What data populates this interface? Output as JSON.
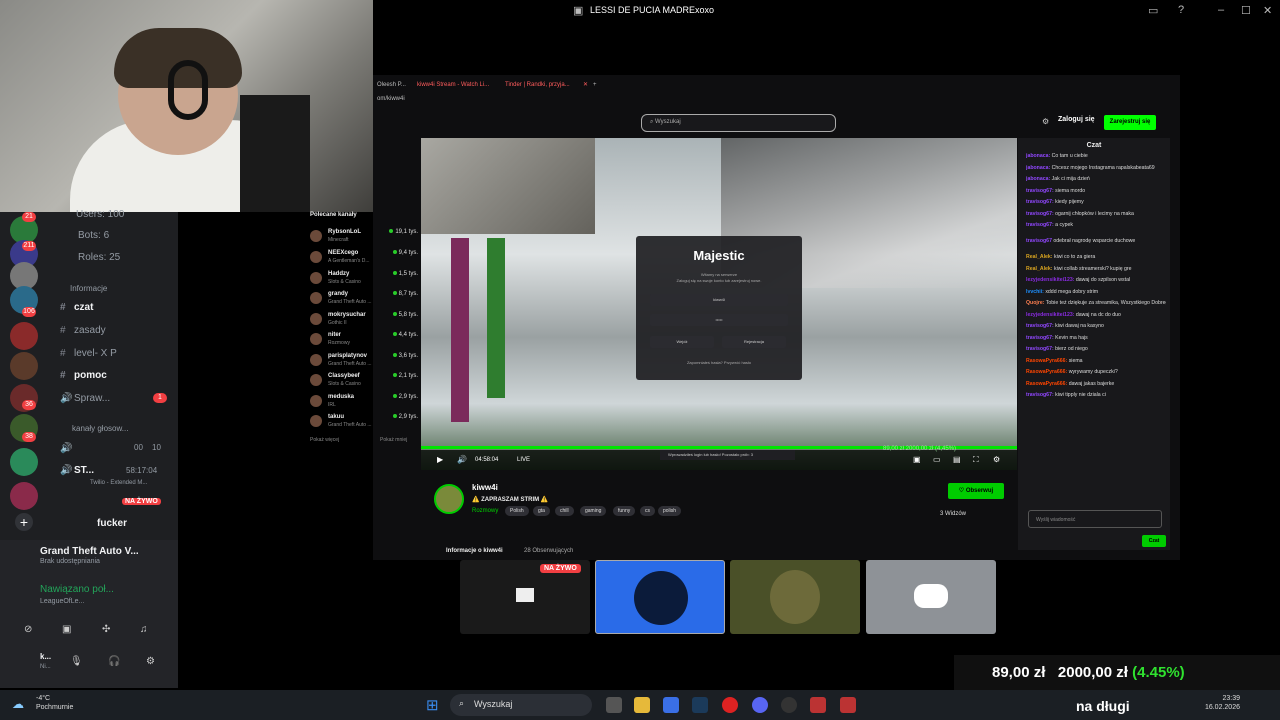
{
  "window": {
    "title": "LESSI DE PUCIA MADRExoxo"
  },
  "discord": {
    "server_counts": [
      "21",
      "211",
      "106",
      "36",
      "38"
    ],
    "server_small_badges": [
      "1",
      "1",
      "1",
      "1",
      "2",
      "1",
      "3"
    ],
    "stats": [
      "Users: 100",
      "Bots: 6",
      "Roles: 25"
    ],
    "category_info": "Informacje",
    "channels": [
      {
        "name": "czat",
        "active": true
      },
      {
        "name": "zasady",
        "active": false
      },
      {
        "name": "level- X P",
        "active": false
      },
      {
        "name": "pomoc",
        "active": true
      }
    ],
    "voice_channel": "Spraw...",
    "voice_badge": "1",
    "category_voice": "kanały głosow...",
    "voice_row_counts": [
      "00",
      "10"
    ],
    "voice_user_prefix": "ST...",
    "activity_time": "58:17:04",
    "activity_line": "Twilio - Extended M...",
    "live_label": "NA ŻYWO",
    "member_name": "fucker",
    "game_activity": {
      "title": "Grand Theft Auto V...",
      "subtitle": "Brak udostępniania"
    },
    "connection": {
      "status": "Nawiązano poł...",
      "server": "LeagueOfLe..."
    },
    "user": {
      "name": "k...",
      "status": "Ni..."
    },
    "thumbnails": [
      {
        "label": "NA ŻYWO",
        "kind": "screen"
      },
      {
        "label": "",
        "kind": "voice-active"
      },
      {
        "label": "",
        "kind": "avatar"
      },
      {
        "label": "",
        "kind": "discord-logo"
      }
    ]
  },
  "browser": {
    "tabs": [
      "Oleesh P...",
      "kiww4i Stream - Watch Li...",
      "Tinder | Randki, przyja..."
    ],
    "url_fragment": "om/kiww4i",
    "search_placeholder": "Wyszukaj",
    "login_label": "Zaloguj się",
    "signup_label": "Zarejestruj się"
  },
  "recommended": {
    "header": "Polecane kanały",
    "channels": [
      {
        "name": "RybsonLoL",
        "game": "Minecraft",
        "viewers": "19,1 tys."
      },
      {
        "name": "NEEXcego",
        "game": "A Gentleman's D...",
        "viewers": "9,4 tys."
      },
      {
        "name": "Haddzy",
        "game": "Slots & Casino",
        "viewers": "1,5 tys."
      },
      {
        "name": "grandy",
        "game": "Grand Theft Auto ...",
        "viewers": "8,7 tys."
      },
      {
        "name": "mokrysuchar",
        "game": "Gothic II",
        "viewers": "5,8 tys."
      },
      {
        "name": "niter",
        "game": "Rozmowy",
        "viewers": "4,4 tys."
      },
      {
        "name": "parisplatynov",
        "game": "Grand Theft Auto ...",
        "viewers": "3,6 tys."
      },
      {
        "name": "Classybeef",
        "game": "Slots & Casino",
        "viewers": "2,1 tys."
      },
      {
        "name": "meduska",
        "game": "IRL",
        "viewers": "2,9 tys."
      },
      {
        "name": "takuu",
        "game": "Grand Theft Auto ...",
        "viewers": "2,9 tys."
      }
    ],
    "show_more": "Pokaż więcej",
    "show_less": "Pokaż mniej"
  },
  "video": {
    "login_logo": "Majestic",
    "login_sub": "Witamy na serwerze",
    "login_sub2": "Zaloguj się na swoje konto lub zarejestruj nowe.",
    "login_field_1": "kiww4i",
    "login_field_2": "•••••",
    "login_btn_1": "Wejdź",
    "login_btn_2": "Rejestracja",
    "login_footer": "Zapomniałeś hasła?  Przywróć hasło",
    "time": "04:58:04",
    "live": "LIVE",
    "message": "Wprowadziłeś login lub hasło! Pozostało prób: 3",
    "overlay_text": "89,00 zł  2000,00 zł  (4,45%)"
  },
  "stream": {
    "channel": "kiww4i",
    "title": "⚠️ ZAPRASZAM STRIM ⚠️",
    "category": "Rozmowy",
    "tags": [
      "Polish",
      "gta",
      "chill",
      "gaming",
      "funny",
      "cs",
      "polish"
    ],
    "follow": "Obserwuj",
    "viewers": "3 Widzów",
    "about": "Informacje o kiww4i",
    "followers": "28 Obserwujących"
  },
  "chat": {
    "title": "Czat",
    "messages": [
      {
        "user": "jabonaca:",
        "text": " Co tam u ciebie",
        "color": "#9147ff"
      },
      {
        "user": "jabonaca:",
        "text": " Chcesz mojego Instagrama rapalskabeata69",
        "color": "#9147ff"
      },
      {
        "user": "jabonaca:",
        "text": " Jak ci mija dzień",
        "color": "#9147ff"
      },
      {
        "user": "travisog67:",
        "text": " siema mordo",
        "color": "#9147ff"
      },
      {
        "user": "travisog67:",
        "text": " kiedy pijemy",
        "color": "#9147ff"
      },
      {
        "user": "travisog67:",
        "text": " ogarnij chłopków i lecimy na maka",
        "color": "#9147ff"
      },
      {
        "user": "travisog67:",
        "text": " a cypek",
        "color": "#9147ff"
      },
      {
        "user": "travisog67",
        "text": " odebrał nagrodę wsparcie duchowe",
        "color": "#9147ff"
      },
      {
        "user": "Real_Alek:",
        "text": " kiwi co to za gierа",
        "color": "#daa520"
      },
      {
        "user": "Real_Alek:",
        "text": " kiwi collab streamerski? kupię gre",
        "color": "#daa520"
      },
      {
        "user": "lezyjedensikitei123:",
        "text": " dawaj do szpilson wstal",
        "color": "#8a2be2"
      },
      {
        "user": "lvvchii:",
        "text": " xddd mega dobry strim",
        "color": "#1e90ff"
      },
      {
        "user": "Quojre:",
        "text": " Tobie też dziękuje za streamika, Wszystkiego Dobrego :D",
        "color": "#ff7f50"
      },
      {
        "user": "lezyjedensikitei123:",
        "text": " dawaj na dc do duo",
        "color": "#8a2be2"
      },
      {
        "user": "travisog67:",
        "text": " kiwi dawaj na kasyno",
        "color": "#9147ff"
      },
      {
        "user": "travisog67:",
        "text": " Kevin ma hajs",
        "color": "#9147ff"
      },
      {
        "user": "travisog67:",
        "text": " bierz od niego",
        "color": "#9147ff"
      },
      {
        "user": "RasowaPyra666:",
        "text": " siema",
        "color": "#ff4500"
      },
      {
        "user": "RasowaPyra666:",
        "text": " wyrywamy dupeczki?",
        "color": "#ff4500"
      },
      {
        "user": "RasowaPyra666:",
        "text": " dawaj jakas bajerke",
        "color": "#ff4500"
      },
      {
        "user": "travisog67:",
        "text": " kiwi tipply nie dziala ci",
        "color": "#9147ff"
      }
    ],
    "input_placeholder": "Wyślij wiadomość",
    "send_label": "Czat"
  },
  "price_overlay": {
    "value1": "89,00 zł",
    "value2": "2000,00 zł",
    "percent": "(4.45%)"
  },
  "taskbar": {
    "weather_temp": "-4°C",
    "weather_desc": "Pochmurnie",
    "search": "Wyszukaj",
    "time": "23:39",
    "date": "16.02.2026",
    "overlay_text": "na długi"
  }
}
